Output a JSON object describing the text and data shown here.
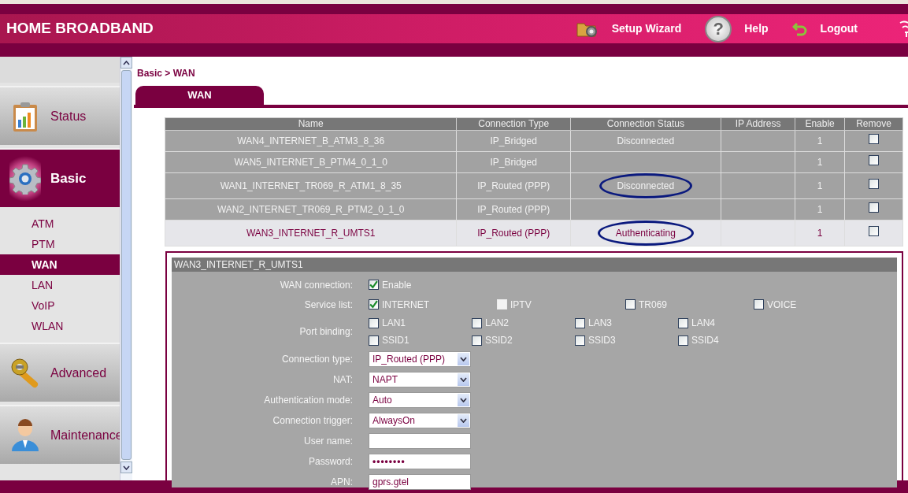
{
  "header": {
    "title": "HOME BROADBAND",
    "links": [
      {
        "kind": "wizard",
        "label": "Setup Wizard"
      },
      {
        "kind": "help",
        "label": "Help",
        "glyph": "?"
      },
      {
        "kind": "logout",
        "label": "Logout"
      }
    ]
  },
  "sidebar": {
    "items": [
      {
        "kind": "status",
        "label": "Status",
        "selected": false
      },
      {
        "kind": "basic",
        "label": "Basic",
        "selected": true,
        "children": [
          {
            "label": "ATM",
            "selected": false
          },
          {
            "label": "PTM",
            "selected": false
          },
          {
            "label": "WAN",
            "selected": true
          },
          {
            "label": "LAN",
            "selected": false
          },
          {
            "label": "VoIP",
            "selected": false
          },
          {
            "label": "WLAN",
            "selected": false
          }
        ]
      },
      {
        "kind": "advanced",
        "label": "Advanced",
        "selected": false
      },
      {
        "kind": "maintenance",
        "label": "Maintenance",
        "selected": false
      }
    ]
  },
  "breadcrumb": "Basic > WAN",
  "tabs": [
    {
      "label": "WAN",
      "selected": true
    }
  ],
  "table": {
    "columns": [
      "Name",
      "Connection Type",
      "Connection Status",
      "IP Address",
      "Enable",
      "Remove"
    ],
    "rows": [
      {
        "name": "WAN4_INTERNET_B_ATM3_8_36",
        "type": "IP_Bridged",
        "status": "Disconnected",
        "enable": "1",
        "remove": false,
        "selected": false,
        "circled": false
      },
      {
        "name": "WAN5_INTERNET_B_PTM4_0_1_0",
        "type": "IP_Bridged",
        "enable": "1",
        "remove": false,
        "selected": false,
        "circled": false
      },
      {
        "name": "WAN1_INTERNET_TR069_R_ATM1_8_35",
        "type": "IP_Routed (PPP)",
        "status": "Disconnected",
        "enable": "1",
        "remove": false,
        "selected": false,
        "circled": true
      },
      {
        "name": "WAN2_INTERNET_TR069_R_PTM2_0_1_0",
        "type": "IP_Routed (PPP)",
        "enable": "1",
        "remove": false,
        "selected": false,
        "circled": false
      },
      {
        "name": "WAN3_INTERNET_R_UMTS1",
        "type": "IP_Routed (PPP)",
        "status": "Authenticating",
        "enable": "1",
        "remove": false,
        "selected": true,
        "circled": true
      }
    ]
  },
  "form": {
    "title": "WAN3_INTERNET_R_UMTS1",
    "fields": [
      {
        "kind": "checkbox-row",
        "label": "WAN connection:",
        "options": [
          {
            "label": "Enable",
            "checked": true,
            "disabled": false
          }
        ]
      },
      {
        "kind": "checkbox-row",
        "label": "Service list:",
        "options": [
          {
            "label": "INTERNET",
            "checked": true,
            "disabled": false
          },
          {
            "label": "IPTV",
            "checked": false,
            "disabled": true
          },
          {
            "label": "TR069",
            "checked": false,
            "disabled": false
          },
          {
            "label": "VOICE",
            "checked": false,
            "disabled": false
          }
        ]
      },
      {
        "kind": "checkbox-grid",
        "label": "Port binding:",
        "options": [
          {
            "label": "LAN1",
            "checked": false,
            "disabled": false
          },
          {
            "label": "LAN2",
            "checked": false,
            "disabled": false
          },
          {
            "label": "LAN3",
            "checked": false,
            "disabled": false
          },
          {
            "label": "LAN4",
            "checked": false,
            "disabled": false
          },
          {
            "label": "SSID1",
            "checked": false,
            "disabled": false
          },
          {
            "label": "SSID2",
            "checked": false,
            "disabled": false
          },
          {
            "label": "SSID3",
            "checked": false,
            "disabled": false
          },
          {
            "label": "SSID4",
            "checked": false,
            "disabled": false
          }
        ]
      },
      {
        "kind": "select",
        "label": "Connection type:",
        "value": "IP_Routed (PPP)"
      },
      {
        "kind": "select",
        "label": "NAT:",
        "value": "NAPT"
      },
      {
        "kind": "select",
        "label": "Authentication mode:",
        "value": "Auto"
      },
      {
        "kind": "select",
        "label": "Connection trigger:",
        "value": "AlwaysOn"
      },
      {
        "kind": "text",
        "label": "User name:"
      },
      {
        "kind": "password",
        "label": "Password:",
        "value": "••••••••"
      },
      {
        "kind": "text",
        "label": "APN:",
        "value": "gprs.gtel"
      }
    ]
  }
}
